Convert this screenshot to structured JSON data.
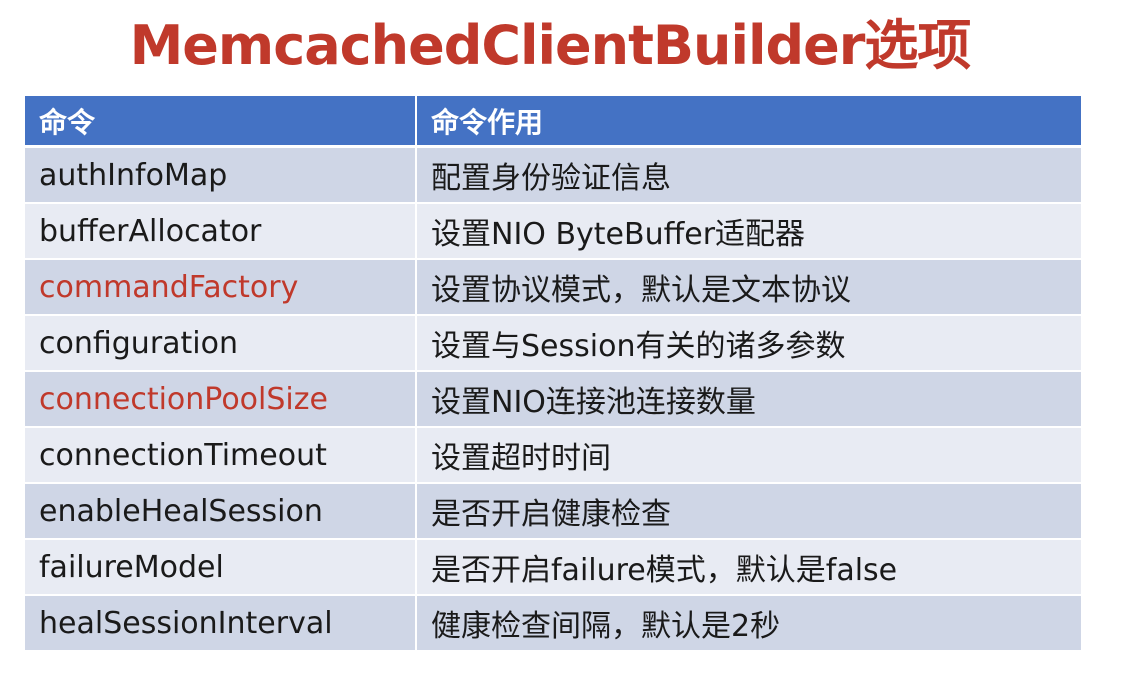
{
  "title": "MemcachedClientBuilder选项",
  "table": {
    "headers": [
      "命令",
      "命令作用"
    ],
    "rows": [
      {
        "command": "authInfoMap",
        "description": "配置身份验证信息",
        "highlight": false
      },
      {
        "command": "bufferAllocator",
        "description": "设置NIO ByteBuffer适配器",
        "highlight": false
      },
      {
        "command": "commandFactory",
        "description": "设置协议模式，默认是文本协议",
        "highlight": true
      },
      {
        "command": "configuration",
        "description": "设置与Session有关的诸多参数",
        "highlight": false
      },
      {
        "command": "connectionPoolSize",
        "description": "设置NIO连接池连接数量",
        "highlight": true
      },
      {
        "command": "connectionTimeout",
        "description": "设置超时时间",
        "highlight": false
      },
      {
        "command": "enableHealSession",
        "description": "是否开启健康检查",
        "highlight": false
      },
      {
        "command": "failureModel",
        "description": "是否开启failure模式，默认是false",
        "highlight": false
      },
      {
        "command": "healSessionInterval",
        "description": "健康检查间隔，默认是2秒",
        "highlight": false
      }
    ]
  },
  "colors": {
    "title": "#c0392b",
    "header_bg": "#4472c4",
    "row_odd": "#cfd6e6",
    "row_even": "#e8ebf3",
    "highlight_text": "#c0392b"
  }
}
